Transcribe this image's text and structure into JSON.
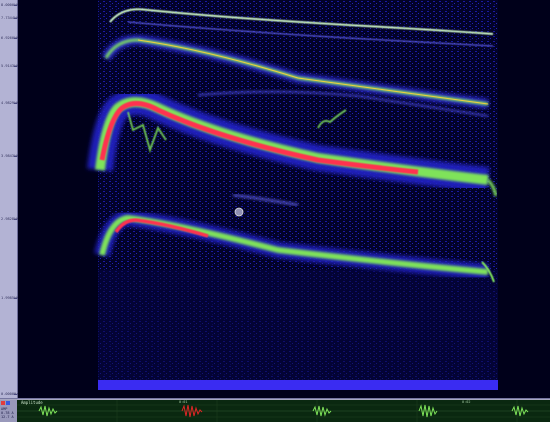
{
  "frequency_axis": {
    "ticks": [
      "8.0000kHz",
      "7.7344kHz",
      "6.9260kHz",
      "5.9143kHz",
      "4.9829kHz",
      "3.9843kHz",
      "2.9828kHz",
      "1.9985kHz",
      "0.0000Hz"
    ]
  },
  "overview": {
    "title": "Amplitude",
    "legend_lines": [
      "AMP",
      "0.78 A",
      "12.7 A"
    ],
    "time_markers": [
      "0:01",
      "0:02"
    ],
    "colors": {
      "waveform": "#7fe35a",
      "selection": "#e02626",
      "legend_swatch_a": "#e23c3c",
      "legend_swatch_b": "#3858e0"
    }
  },
  "spectrogram": {
    "colors": {
      "background": "#00001a",
      "low": "#1a1aa6",
      "mid": "#6fe33a",
      "high": "#ff3050",
      "baseline_band": "#3a2cf2"
    },
    "cursor_icon": "circle-cursor-icon"
  }
}
